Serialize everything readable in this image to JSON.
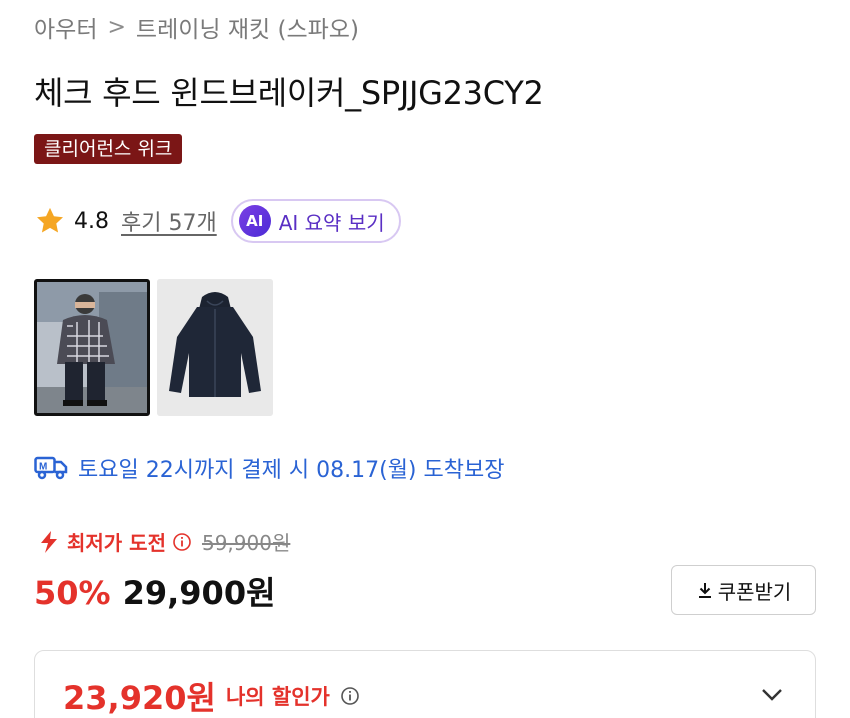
{
  "breadcrumb": {
    "category": "아우터",
    "separator": ">",
    "subcategory": "트레이닝 재킷 (스파오)"
  },
  "product": {
    "title": "체크 후드 윈드브레이커_SPJJG23CY2",
    "badge": "클리어런스 위크"
  },
  "rating": {
    "score": "4.8",
    "reviews": "후기 57개",
    "star_color": "#f5a623"
  },
  "ai_summary": {
    "icon_text": "AI",
    "label": "AI 요약 보기"
  },
  "thumbnails": [
    {
      "icon": "model-photo",
      "selected": true
    },
    {
      "icon": "jacket-photo",
      "selected": false
    }
  ],
  "delivery": {
    "icon": "delivery-truck-icon",
    "text": "토요일 22시까지 결제 시 08.17(월) 도착보장"
  },
  "pricing": {
    "lowest_label": "최저가 도전",
    "original_price": "59,900원",
    "discount": "50%",
    "price": "29,900원",
    "coupon_label": "쿠폰받기",
    "my_price": "23,920원",
    "my_price_label": "나의 할인가",
    "accent_color": "#e4322b"
  }
}
